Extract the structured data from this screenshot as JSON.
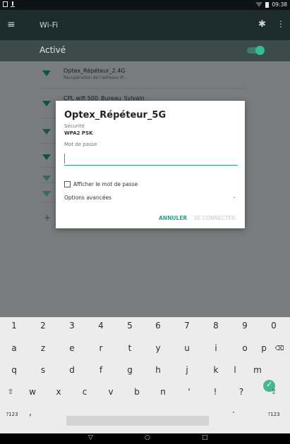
{
  "status_bar": {
    "time": "09:38"
  },
  "app_bar": {
    "title": "Wi-Fi"
  },
  "wifi_toggle": {
    "label": "Activé",
    "state": "on"
  },
  "networks": [
    {
      "ssid": "Optex_Répéteur_2.4G",
      "status": "Récupération de l'adresse IP..."
    },
    {
      "ssid": "CPL wifi 500_Bureau_Sylvain",
      "status": ""
    }
  ],
  "dialog": {
    "title": "Optex_Répéteur_5G",
    "security_label": "Sécurité",
    "security_value": "WPA2 PSK",
    "password_label": "Mot de passe",
    "password_value": "",
    "show_password_label": "Afficher le mot de passe",
    "advanced_label": "Options avancées",
    "cancel_label": "ANNULER",
    "connect_label": "SE CONNECTER"
  },
  "keyboard": {
    "numbers": [
      "1",
      "2",
      "3",
      "4",
      "5",
      "6",
      "7",
      "8",
      "9",
      "0"
    ],
    "row1": [
      "a",
      "z",
      "e",
      "r",
      "t",
      "y",
      "u",
      "i",
      "o",
      "p"
    ],
    "row2": [
      "q",
      "s",
      "d",
      "f",
      "g",
      "h",
      "j",
      "k",
      "l",
      "m"
    ],
    "row3": [
      "w",
      "x",
      "c",
      "v",
      "b",
      "n",
      "'",
      "!",
      "?"
    ],
    "symbols_label": "?123",
    "comma": ",",
    "period": "·"
  },
  "colors": {
    "accent": "#26a58a",
    "appbar": "#1b2b2e",
    "wifi_icon": "#0a5444"
  }
}
